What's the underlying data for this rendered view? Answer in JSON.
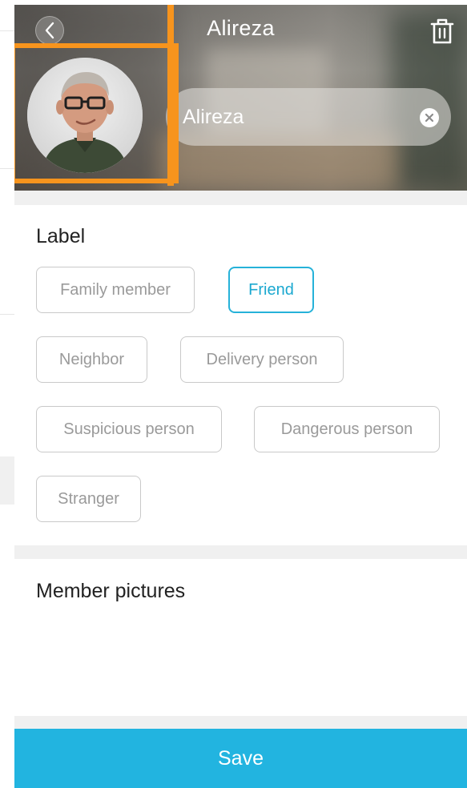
{
  "header": {
    "title": "Alireza",
    "back_icon": "chevron-left-icon",
    "delete_icon": "trash-icon",
    "name_value": "Alireza",
    "clear_icon": "clear-circle-icon"
  },
  "label_section": {
    "title": "Label",
    "options": [
      {
        "label": "Family member",
        "selected": false
      },
      {
        "label": "Friend",
        "selected": true
      },
      {
        "label": "Neighbor",
        "selected": false
      },
      {
        "label": "Delivery person",
        "selected": false
      },
      {
        "label": "Suspicious person",
        "selected": false
      },
      {
        "label": "Dangerous person",
        "selected": false
      },
      {
        "label": "Stranger",
        "selected": false
      }
    ]
  },
  "pictures_section": {
    "title": "Member pictures"
  },
  "footer": {
    "save_label": "Save"
  },
  "colors": {
    "accent": "#22b4e0",
    "highlight": "#f7941d",
    "chip_border": "#c9c9c9",
    "chip_text": "#9a9a9a"
  }
}
